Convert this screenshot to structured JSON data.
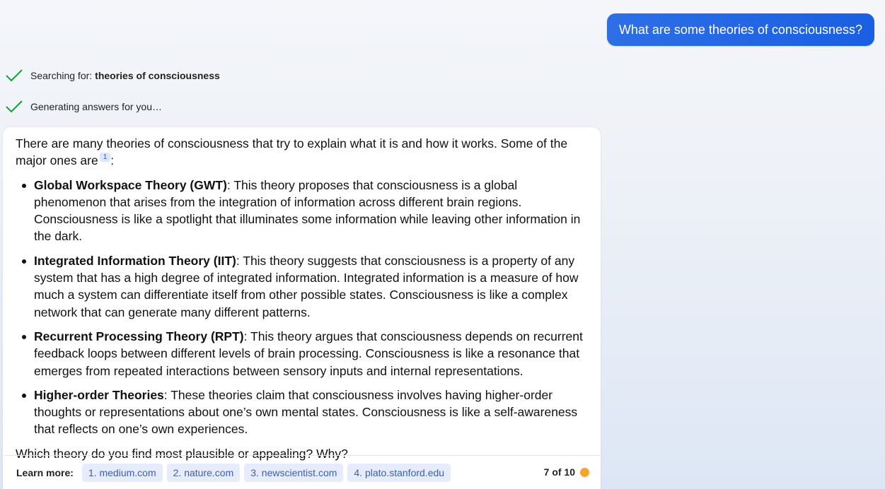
{
  "user_message": "What are some theories of consciousness?",
  "status": {
    "searching_prefix": "Searching for:",
    "searching_query": "theories of consciousness",
    "generating": "Generating answers for you…",
    "check_color": "#1a9e3a"
  },
  "answer": {
    "intro": "There are many theories of consciousness that try to explain what it is and how it works. Some of the major ones are",
    "intro_citation": "1",
    "intro_suffix": ":",
    "theories": [
      {
        "name": "Global Workspace Theory (GWT)",
        "text": ": This theory proposes that consciousness is a global phenomenon that arises from the integration of information across different brain regions. Consciousness is like a spotlight that illuminates some information while leaving other information in the dark."
      },
      {
        "name": "Integrated Information Theory (IIT)",
        "text": ": This theory suggests that consciousness is a property of any system that has a high degree of integrated information. Integrated information is a measure of how much a system can differentiate itself from other possible states. Consciousness is like a complex network that can generate many different patterns."
      },
      {
        "name": "Recurrent Processing Theory (RPT)",
        "text": ": This theory argues that consciousness depends on recurrent feedback loops between different levels of brain processing. Consciousness is like a resonance that emerges from repeated interactions between sensory inputs and internal representations."
      },
      {
        "name": "Higher-order Theories",
        "text": ": These theories claim that consciousness involves having higher-order thoughts or representations about one’s own mental states. Consciousness is like a self-awareness that reflects on one’s own experiences."
      }
    ],
    "question": "Which theory do you find most plausible or appealing? Why?"
  },
  "learn_more": {
    "label": "Learn more:",
    "sources": [
      "1. medium.com",
      "2. nature.com",
      "3. newscientist.com",
      "4. plato.stanford.edu"
    ]
  },
  "turn_counter": {
    "text": "7 of 10",
    "dot_color": "#f4a52b"
  }
}
